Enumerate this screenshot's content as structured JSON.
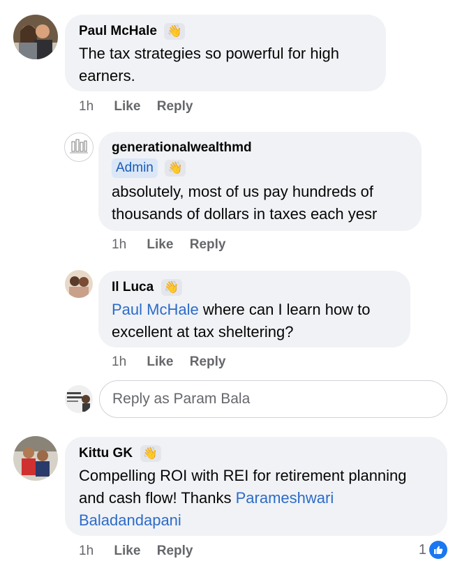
{
  "comments": [
    {
      "name": "Paul McHale",
      "text": "The tax strategies so powerful for high earners.",
      "time": "1h",
      "like": "Like",
      "reply": "Reply"
    },
    {
      "name": "generationalwealthmd",
      "badge": "Admin",
      "text": "absolutely, most of us pay hundreds of thousands of dollars in taxes each yesr",
      "time": "1h",
      "like": "Like",
      "reply": "Reply"
    },
    {
      "name": "Il Luca",
      "mention": "Paul McHale",
      "text": " where can I learn how to excellent at tax sheltering?",
      "time": "1h",
      "like": "Like",
      "reply": "Reply"
    },
    {
      "name": "Kittu GK",
      "text": "Compelling ROI with REI for retirement planning and cash flow!  Thanks ",
      "mention": "Parameshwari Baladandapani",
      "time": "1h",
      "like": "Like",
      "reply": "Reply",
      "reaction_count": "1"
    }
  ],
  "reply_box": {
    "placeholder": "Reply as Param Bala"
  },
  "icons": {
    "wave": "waving-hand-icon",
    "like": "thumbs-up-icon"
  },
  "colors": {
    "bubble": "#f0f2f5",
    "link": "#2c6bc9",
    "like_blue": "#1a77f2"
  }
}
